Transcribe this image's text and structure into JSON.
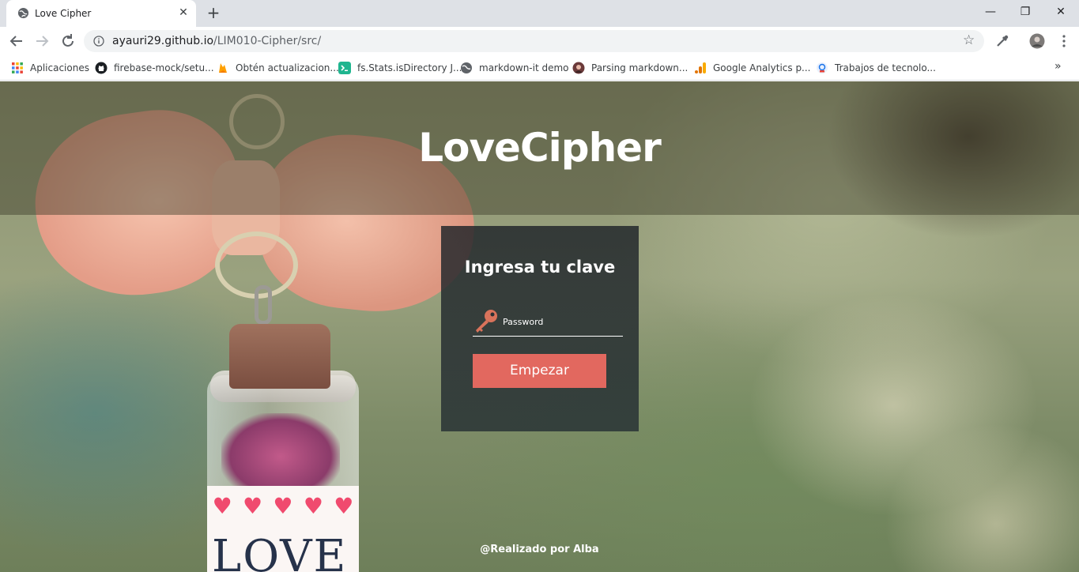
{
  "browser": {
    "tab_title": "Love Cipher",
    "tab_close": "✕",
    "new_tab": "+",
    "window_minimize": "—",
    "window_restore": "❐",
    "window_close": "✕",
    "url_host": "ayauri29.github.io",
    "url_path": "/LIM010-Cipher/src/",
    "more_bookmarks": "»",
    "bookmarks": [
      {
        "label": "Aplicaciones",
        "icon": "apps-grid-icon"
      },
      {
        "label": "firebase-mock/setu...",
        "icon": "github-icon"
      },
      {
        "label": "Obtén actualizacion...",
        "icon": "firebase-icon"
      },
      {
        "label": "fs.Stats.isDirectory J...",
        "icon": "terminal-icon"
      },
      {
        "label": "markdown-it demo",
        "icon": "globe-icon"
      },
      {
        "label": "Parsing markdown...",
        "icon": "avatar-icon"
      },
      {
        "label": "Google Analytics p...",
        "icon": "analytics-icon"
      },
      {
        "label": "Trabajos de tecnolo...",
        "icon": "job-icon"
      }
    ]
  },
  "page": {
    "brand": "LoveCipher",
    "card_title": "Ingresa tu clave",
    "password_placeholder": "Password",
    "start_button": "Empezar",
    "footer": "@Realizado por Alba",
    "bottle_hearts": [
      "♥",
      "♥",
      "♥",
      "♥",
      "♥"
    ],
    "bottle_word": "LOVE"
  },
  "colors": {
    "accent_button": "#e2685f",
    "key_icon": "#d9735b"
  }
}
